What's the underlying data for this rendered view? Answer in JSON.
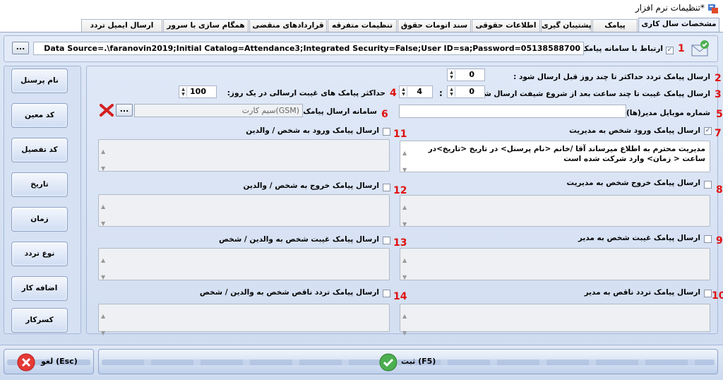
{
  "window": {
    "title": "تنظیمات نرم افزار*"
  },
  "tabs": [
    "مشخصات سال کاری",
    "پیامک",
    "پشتیبان گیری",
    "اطلاعات حقوقی",
    "سند اتومات حقوق",
    "تنظیمات متفرقه",
    "قراردادهای منقضی",
    "همگام سازی با سرور",
    "ارسال ایمیل تردد"
  ],
  "connection": {
    "checkbox_label": "ارتباط با سامانه پیامک",
    "number": "1",
    "conn_string": "Data Source=.\\faranovin2019;Initial Catalog=Attendance3;Integrated Security=False;User ID=sa;Password=05138588700",
    "browse_label": "..."
  },
  "settings": {
    "row2": {
      "number": "2",
      "label": "ارسال پیامک تردد حداکثر تا چند روز قبل ارسال شود :",
      "value": "0"
    },
    "row3": {
      "number": "3",
      "label": "ارسال پیامک غیبت تا چند ساعت بعد از شروع شیفت ارسال شود :",
      "hours": "0",
      "minutes": "4",
      "sep": ":"
    },
    "row4": {
      "number": "4",
      "label": "حداکثر پیامک های غیبت ارسالی در یک روز:",
      "value": "100"
    },
    "row5": {
      "number": "5",
      "label": "شماره موبایل مدیر(ها) :",
      "value": ""
    },
    "row6": {
      "number": "6",
      "label": "سامانه ارسال پیامک :",
      "value": "سیم کارت(GSM)",
      "browse_label": "..."
    },
    "row7": {
      "number": "7",
      "label": "ارسال پیامک ورود شخص به مدیریت",
      "checked": "✓",
      "message": "مدیریت محترم به اطلاع میرساند آقا /خانم <نام پرسنل> در تاریخ <تاریخ>در ساعت < زمان> وارد شرکت شده است"
    },
    "row8": {
      "number": "8",
      "label": "ارسال پیامک خروج شخص به مدیریت"
    },
    "row9": {
      "number": "9",
      "label": "ارسال پیامک غیبت شخص به مدیر"
    },
    "row10": {
      "number": "10",
      "label": "ارسال پیامک تردد ناقص به مدیر"
    },
    "row11": {
      "number": "11",
      "label": "ارسال پیامک ورود به شخص / والدین"
    },
    "row12": {
      "number": "12",
      "label": "ارسال پیامک خروج به شخص / والدین"
    },
    "row13": {
      "number": "13",
      "label": "ارسال پیامک غیبت شخص به والدین / شخص"
    },
    "row14": {
      "number": "14",
      "label": "ارسال پیامک تردد ناقص شخص به والدین / شخص"
    }
  },
  "side_buttons": [
    "نام پرسنل",
    "کد معین",
    "کد تفصیل",
    "تاریخ",
    "زمان",
    "نوع تردد",
    "اضافه کار",
    "کسرکار"
  ],
  "bottom": {
    "save_label": "ثبت  (F5)",
    "cancel_label": "لغو  (Esc)"
  },
  "colors": {
    "accent": "#e01010",
    "panel": "#d6e1f3",
    "tab_active": "#e8eefb"
  }
}
